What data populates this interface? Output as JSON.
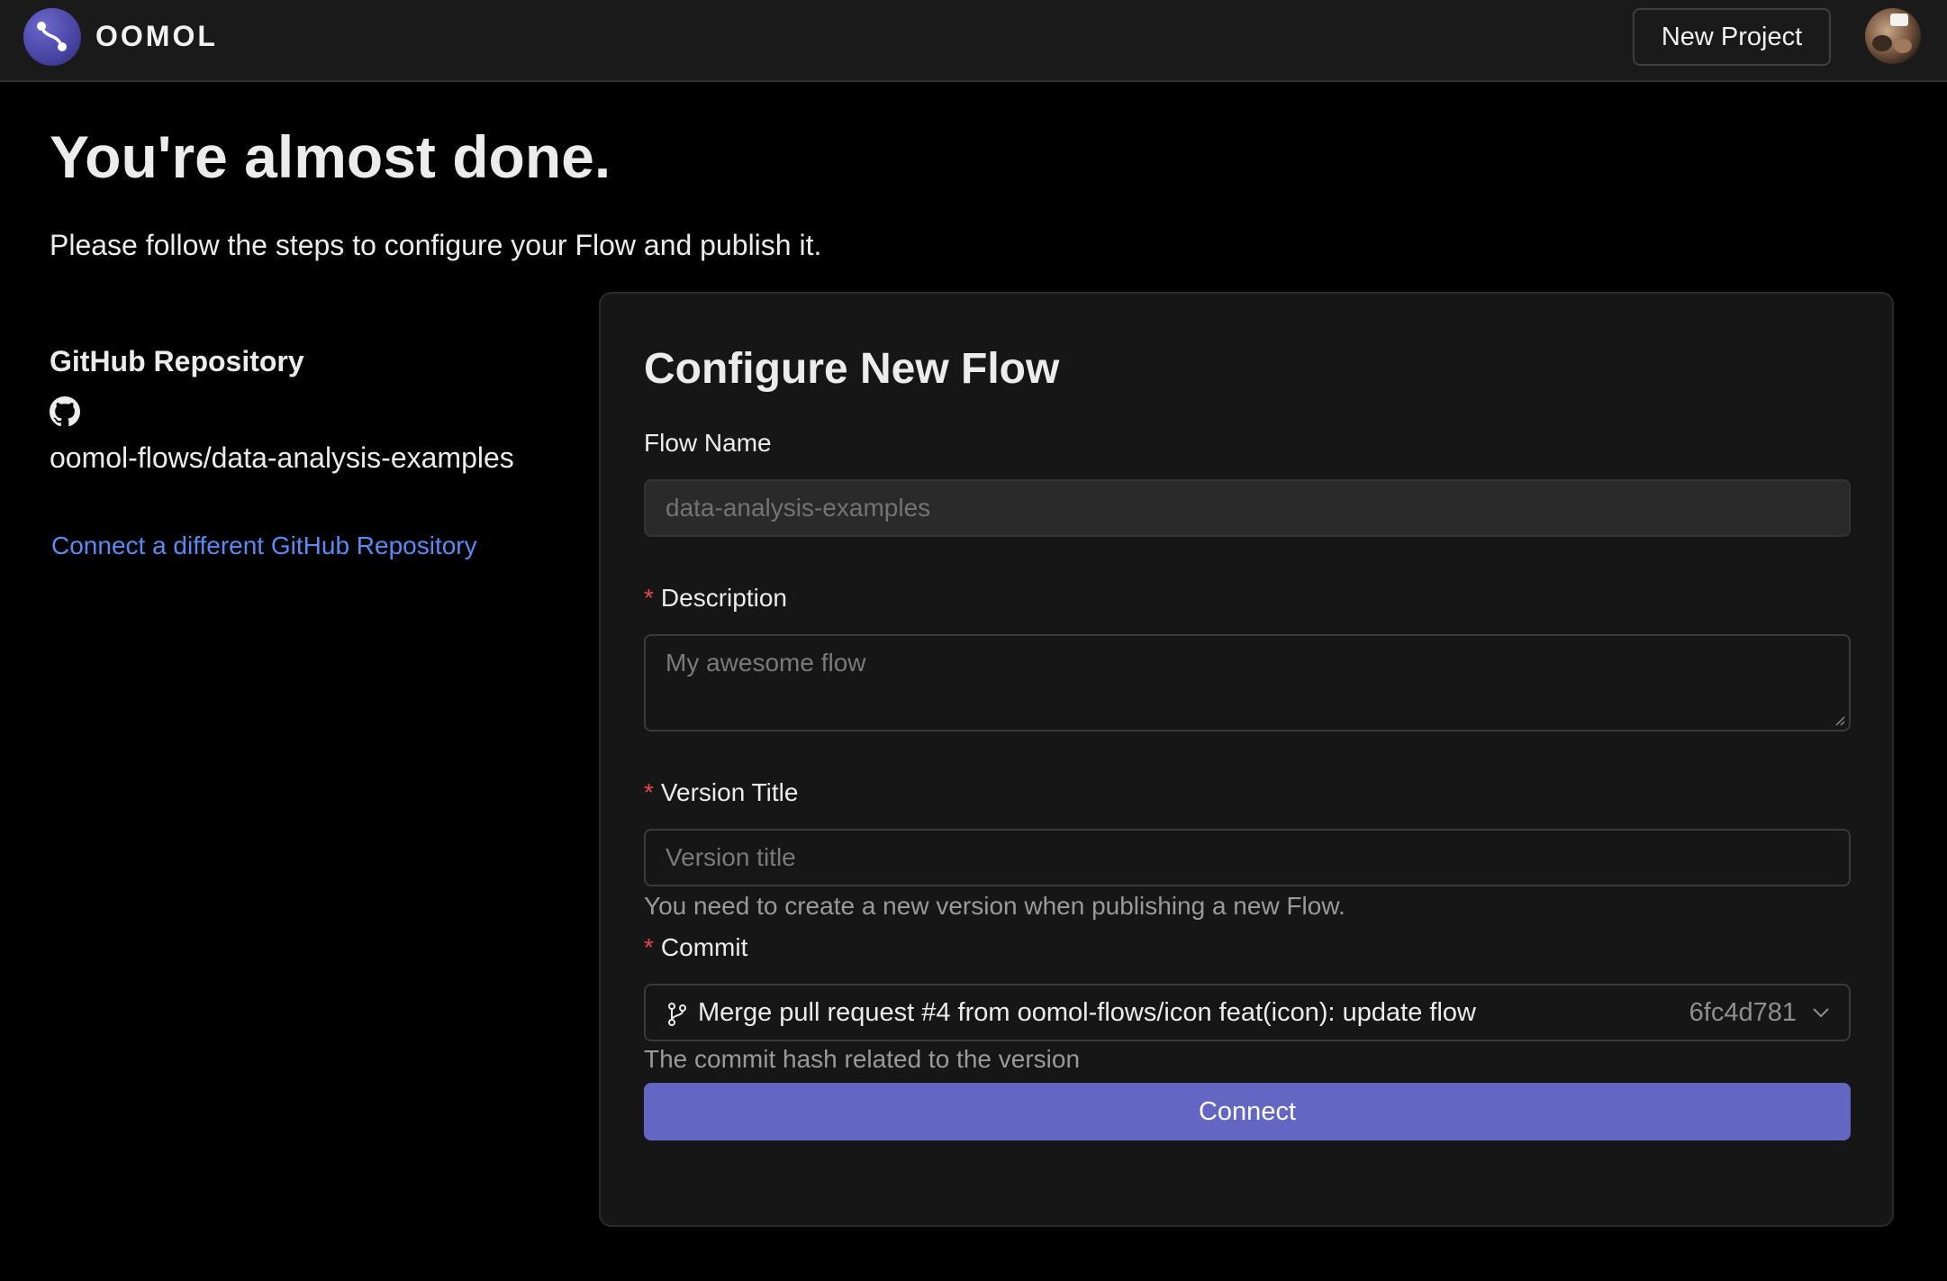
{
  "header": {
    "logo_text": "OOMOL",
    "new_project_label": "New Project"
  },
  "page": {
    "title": "You're almost done.",
    "subtitle": "Please follow the steps to configure your Flow and publish it."
  },
  "repository": {
    "heading": "GitHub Repository",
    "name": "oomol-flows/data-analysis-examples",
    "change_link": "Connect a different GitHub Repository"
  },
  "form": {
    "title": "Configure New Flow",
    "flow_name": {
      "label": "Flow Name",
      "placeholder": "data-analysis-examples"
    },
    "description": {
      "label": "Description",
      "required_mark": "*",
      "placeholder": "My awesome flow"
    },
    "version_title": {
      "label": "Version Title",
      "required_mark": "*",
      "placeholder": "Version title",
      "help": "You need to create a new version when publishing a new Flow."
    },
    "commit": {
      "label": "Commit",
      "required_mark": "*",
      "selected_message": "Merge pull request #4 from oomol-flows/icon feat(icon): update flow",
      "selected_hash": "6fc4d781",
      "help": "The commit hash related to the version"
    },
    "submit_label": "Connect"
  },
  "colors": {
    "background": "#000000",
    "header_bg": "#1a1a1a",
    "card_bg": "#161616",
    "accent": "#6466c4",
    "link": "#5b8bf0",
    "required": "#e5484d"
  },
  "icons": [
    "oomol-logo-icon",
    "github-icon",
    "git-branch-icon",
    "chevron-down-icon",
    "resize-handle-icon"
  ]
}
